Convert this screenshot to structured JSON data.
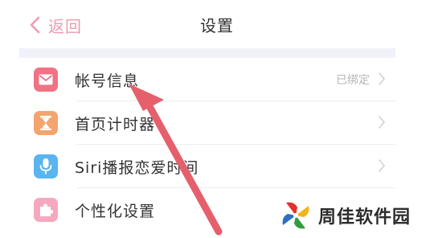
{
  "navbar": {
    "back_label": "返回",
    "title": "设置"
  },
  "settings": {
    "items": [
      {
        "label": "帐号信息",
        "value": "已绑定",
        "icon": "mail-icon",
        "icon_color": "#f07285"
      },
      {
        "label": "首页计时器",
        "value": "",
        "icon": "hourglass-icon",
        "icon_color": "#f4a56e"
      },
      {
        "label": "Siri播报恋爱时间",
        "value": "",
        "icon": "microphone-icon",
        "icon_color": "#5ab4ee"
      },
      {
        "label": "个性化设置",
        "value": "",
        "icon": "puzzle-icon",
        "icon_color": "#f5a9be"
      }
    ]
  },
  "watermark": {
    "text": "周佳软件园"
  },
  "colors": {
    "accent": "#ee9bb0",
    "annotation_arrow": "#e5606c",
    "divider": "#ececec",
    "section_background": "#f1f1fa"
  }
}
